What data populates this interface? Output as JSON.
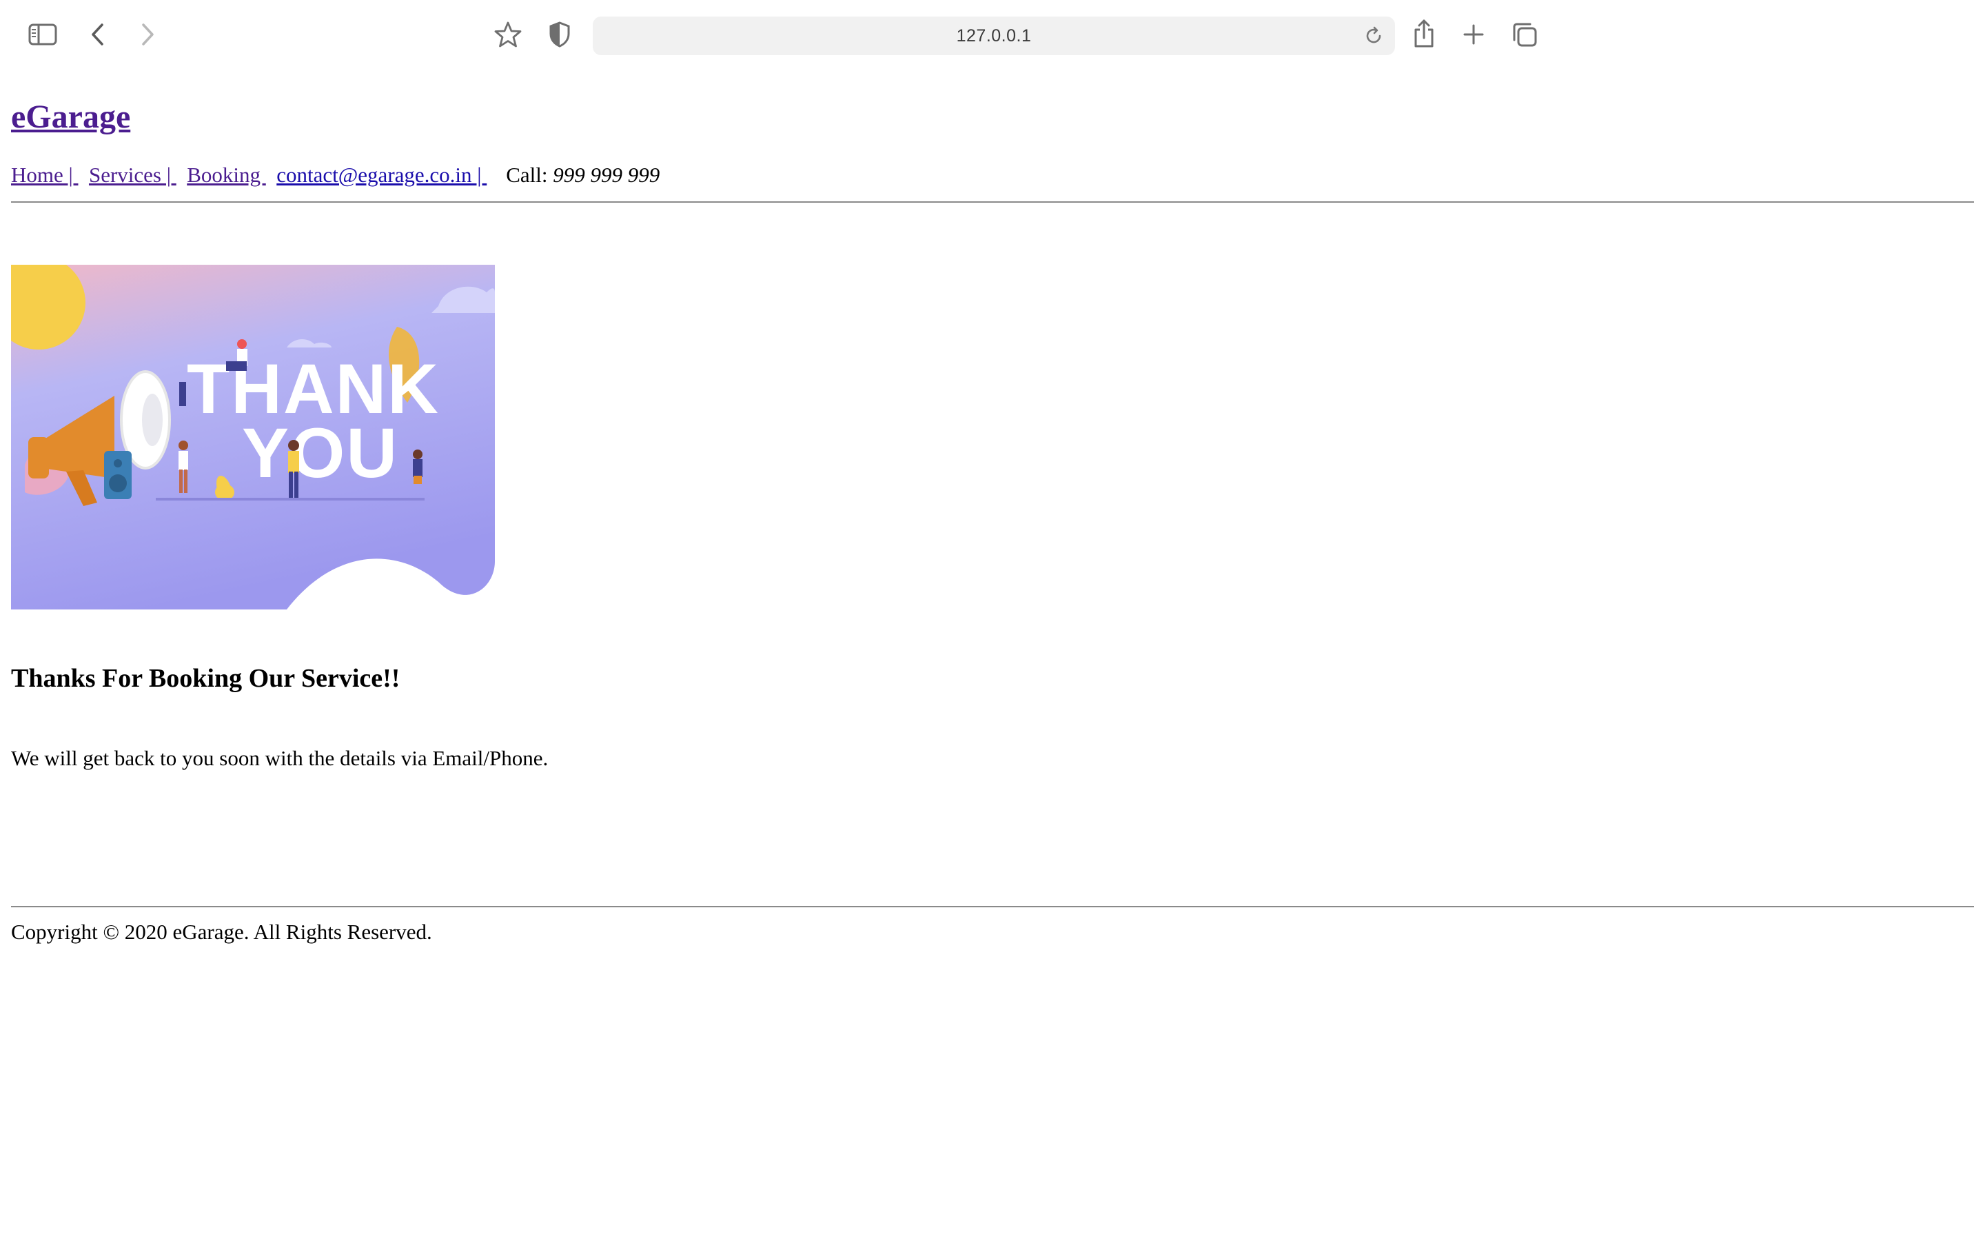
{
  "browser": {
    "url": "127.0.0.1",
    "icons": [
      "sidebar-icon",
      "back-arrow-icon",
      "forward-arrow-icon",
      "star-icon",
      "shield-icon",
      "reload-icon",
      "share-icon",
      "plus-icon",
      "tabs-icon"
    ]
  },
  "site": {
    "title": "eGarage",
    "nav": {
      "home": "Home | ",
      "services": "Services | ",
      "booking": "Booking ",
      "contact": "contact@egarage.co.in | ",
      "call_label": "Call: ",
      "call_number": "999 999 999"
    }
  },
  "hero": {
    "image_text_line1": "THANK",
    "image_text_line2": "YOU"
  },
  "main": {
    "headline": "Thanks For Booking Our Service!!",
    "message": "We will get back to you soon with the details via Email/Phone."
  },
  "footer": {
    "copyright": "Copyright © 2020 eGarage. All Rights Reserved."
  },
  "colors": {
    "link_visited": "#4b1d8f",
    "link": "#1a0dab",
    "hero_purple": "#9a98f0",
    "sun": "#f6ce4a",
    "megaphone_orange": "#e28b2c"
  }
}
